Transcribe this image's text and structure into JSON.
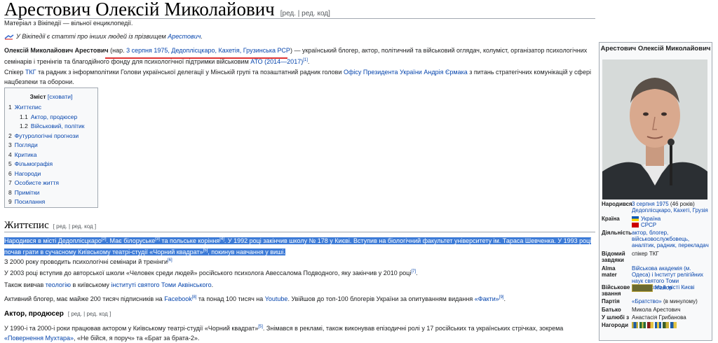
{
  "title": "Арестович Олексій Миколайович",
  "title_edit": "[ред. | ред. код]",
  "tagline": "Матеріал з Вікіпедії — вільної енциклопедії.",
  "hatnote": {
    "text": "У Вікіпедії є статті про інших людей із прізвищем ",
    "link": "Арестович"
  },
  "intro": {
    "name": "Олексій Миколайович Арестович",
    "born_prefix": " (нар. ",
    "born": "3 серпня 1975, Дедоплісцкаро, Кахетія, Грузинська РСР",
    "rest1": ") — український блогер, актор, політичний та військовий оглядач, колуміст, організатор психологічних семінарів і тренінгів та благодійного фонду для психологічної підтримки військовим ",
    "ato": "АТО (2014—2017)",
    "ref": "[1]",
    "end": "."
  },
  "para2": {
    "t1": "Спікер ",
    "tkg": "ТКГ",
    "t2": " та радник з інформполітики Голови української делегації у Мінській групі та позаштатний радник голови ",
    "office": "Офісу Президента України",
    "t3": " ",
    "yermak": "Андрія Єрмака",
    "t4": " з питань стратегічних комунікацій у сфері нацбезпеки та оборони."
  },
  "toc": {
    "title": "Зміст",
    "toggle": "[сховати]",
    "items": [
      {
        "num": "1",
        "label": "Життєпис"
      },
      {
        "num": "1.1",
        "label": "Актор, продюсер"
      },
      {
        "num": "1.2",
        "label": "Військовий, політик"
      },
      {
        "num": "2",
        "label": "Футурологічні прогнози"
      },
      {
        "num": "3",
        "label": "Погляди"
      },
      {
        "num": "4",
        "label": "Критика"
      },
      {
        "num": "5",
        "label": "Фільмографія"
      },
      {
        "num": "6",
        "label": "Нагороди"
      },
      {
        "num": "7",
        "label": "Особисте життя"
      },
      {
        "num": "8",
        "label": "Примітки"
      },
      {
        "num": "9",
        "label": "Посилання"
      }
    ]
  },
  "section_life": {
    "title": "Життєпис",
    "edit": "[ ред. | ред. код ]"
  },
  "bio": {
    "s1": "Народився в місті ",
    "s1l": "Дедоплісцкаро",
    "r2": "[2]",
    "s2": ". Має білоруське",
    "r3": "[3]",
    "s3": " та польське коріння",
    "r4": "[4]",
    "s4": ". У 1992 році закінчив школу № 178 у Києві. Вступив на біологічний факультет університету ім. Тараса Шевченка. У 1993 році почав грати в сучасному Київському театрі-студії «Чорний квадрат»",
    "r5": "[5]",
    "s5": ", покинув навчання у виші."
  },
  "p_2000": {
    "text": "З 2000 року проводить психологічні семінари й тренінги",
    "ref": "[6]"
  },
  "p_2003": {
    "text": "У 2003 році вступив до авторської школи «Человек среди людей» російського психолога Авессалома Подводного, яку закінчив у 2010 році",
    "ref": "[7]",
    "end": "."
  },
  "p_theo": {
    "t1": "Також вивчав ",
    "l1": "теологію",
    "t2": " в київському ",
    "l2": "інституті святого Томи Аквінського",
    "t3": "."
  },
  "p_blog": {
    "t1": "Активний блогер, має майже 200 тисяч підписників на ",
    "fb": "Facebook",
    "r8": "[8]",
    "t2": " та понад 100 тисяч на ",
    "yt": "Youtube",
    "t3": ". Увійшов до топ-100 блогерів України за опитуванням видання ",
    "fakty": "«Факти»",
    "r9": "[9]",
    "t4": "."
  },
  "section_actor": {
    "title": "Актор, продюсер",
    "edit": "[ ред. | ред. код ]"
  },
  "p_actor": {
    "t1": "У 1990-і та 2000-і роки працював актором у Київському театрі-студії «Чорний квадрат»",
    "r5": "[5]",
    "t2": ". Знімався в рекламі, також виконував епізодичні ролі у 17 російських та українських стрічках, зокрема ",
    "l1": "«Повернення Мухтара»",
    "t3": ", «Не бійся, я поруч» та «Брат за брата-2»."
  },
  "infobox": {
    "title": "Арестович Олексій Миколайович",
    "rows": {
      "born_k": "Народився",
      "born_date": "3 серпня 1975",
      "born_age": " (46 років)",
      "born_place": "Дедоплісцкаро, Кахеті, Грузія",
      "country_k": "Країна",
      "country1": "Україна",
      "country2": "СРСР",
      "activity_k": "Діяльність",
      "activity_v": "актор, блогер, військовослужбовець, аналітик, радник, перекладач",
      "faction_k": "Відомий завдяки",
      "faction_v": "спікер ТКГ",
      "alma_k": "Alma mater",
      "alma_v": "Військова академія (м. Одеса) і Інститут релігійних наук святого Томи Аквінського в місті Києві",
      "rank_k": "Військове звання",
      "rank_v": "Майор",
      "party_k": "Партія",
      "party_v": "«Братство»",
      "party_note": " (в минулому)",
      "father_k": "Батько",
      "father_v": "Микола Арестович",
      "spouse_k": "У шлюбі з",
      "spouse_v": "Анастасія Грибанова",
      "awards_k": "Нагороди"
    }
  },
  "colors": {
    "link": "#0645ad",
    "selection": "#3d7bd7",
    "border": "#a2a9b1"
  }
}
